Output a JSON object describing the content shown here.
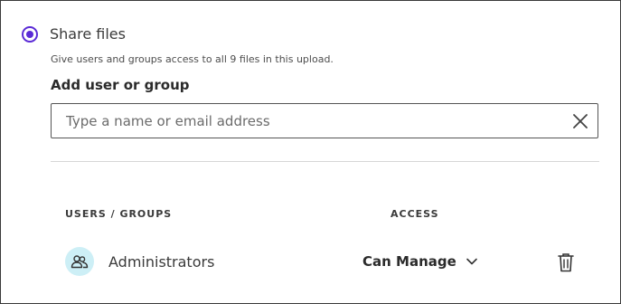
{
  "share": {
    "label": "Share files",
    "help_text": "Give users and groups access to all 9 files in this upload.",
    "selected": true
  },
  "add": {
    "label": "Add user or group",
    "placeholder": "Type a name or email address",
    "value": ""
  },
  "table": {
    "headers": {
      "users": "USERS / GROUPS",
      "access": "ACCESS"
    },
    "rows": [
      {
        "name": "Administrators",
        "access": "Can Manage",
        "icon": "group-icon"
      }
    ]
  },
  "colors": {
    "accent": "#5b2bd6",
    "avatar_bg": "#cdeff6"
  }
}
